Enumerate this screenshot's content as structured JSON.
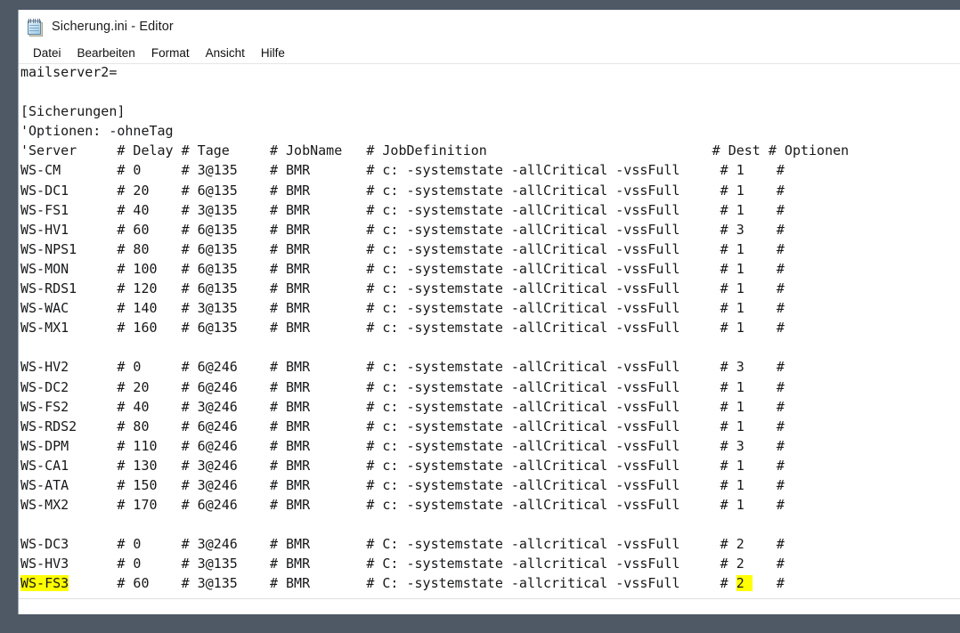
{
  "window": {
    "title": "Sicherung.ini - Editor",
    "icon": "notepad-icon"
  },
  "menu": {
    "items": [
      {
        "label": "Datei"
      },
      {
        "label": "Bearbeiten"
      },
      {
        "label": "Format"
      },
      {
        "label": "Ansicht"
      },
      {
        "label": "Hilfe"
      }
    ]
  },
  "colors": {
    "desktop": "#4e5965",
    "window": "#ffffff",
    "text": "#17181a",
    "highlight": "#ffff00"
  },
  "document": {
    "filename": "Sicherung.ini",
    "lines": [
      "mailserver2=",
      "",
      "[Sicherungen]",
      "'Optionen: -ohneTag",
      "'Server     # Delay # Tage     # JobName   # JobDefinition                            # Dest # Optionen",
      "WS-CM       # 0     # 3@135    # BMR       # c: -systemstate -allCritical -vssFull     # 1    #",
      "WS-DC1      # 20    # 6@135    # BMR       # c: -systemstate -allCritical -vssFull     # 1    #",
      "WS-FS1      # 40    # 3@135    # BMR       # c: -systemstate -allCritical -vssFull     # 1    #",
      "WS-HV1      # 60    # 6@135    # BMR       # c: -systemstate -allCritical -vssFull     # 3    #",
      "WS-NPS1     # 80    # 6@135    # BMR       # c: -systemstate -allCritical -vssFull     # 1    #",
      "WS-MON      # 100   # 6@135    # BMR       # c: -systemstate -allCritical -vssFull     # 1    #",
      "WS-RDS1     # 120   # 6@135    # BMR       # c: -systemstate -allCritical -vssFull     # 1    #",
      "WS-WAC      # 140   # 3@135    # BMR       # c: -systemstate -allCritical -vssFull     # 1    #",
      "WS-MX1      # 160   # 6@135    # BMR       # c: -systemstate -allCritical -vssFull     # 1    #",
      "",
      "WS-HV2      # 0     # 6@246    # BMR       # c: -systemstate -allCritical -vssFull     # 3    #",
      "WS-DC2      # 20    # 6@246    # BMR       # c: -systemstate -allCritical -vssFull     # 1    #",
      "WS-FS2      # 40    # 3@246    # BMR       # c: -systemstate -allCritical -vssFull     # 1    #",
      "WS-RDS2     # 80    # 6@246    # BMR       # c: -systemstate -allCritical -vssFull     # 1    #",
      "WS-DPM      # 110   # 6@246    # BMR       # c: -systemstate -allCritical -vssFull     # 3    #",
      "WS-CA1      # 130   # 3@246    # BMR       # c: -systemstate -allCritical -vssFull     # 1    #",
      "WS-ATA      # 150   # 3@246    # BMR       # c: -systemstate -allCritical -vssFull     # 1    #",
      "WS-MX2      # 170   # 6@246    # BMR       # c: -systemstate -allCritical -vssFull     # 1    #",
      "",
      "WS-DC3      # 0     # 3@246    # BMR       # C: -systemstate -allcritical -vssFull     # 2    #",
      "WS-HV3      # 0     # 3@135    # BMR       # C: -systemstate -allcritical -vssFull     # 2    #",
      "WS-FS3      # 60    # 3@135    # BMR       # C: -systemstate -allcritical -vssFull     # 2    #"
    ],
    "columns": [
      "Server",
      "Delay",
      "Tage",
      "JobName",
      "JobDefinition",
      "Dest",
      "Optionen"
    ],
    "highlighted": {
      "line_index": 26,
      "server_name": "WS-FS3",
      "dest_value": "2"
    },
    "last_line": {
      "server": "WS-FS3",
      "delay": "60",
      "tage": "3@135",
      "jobname": "BMR",
      "jobdefinition": "C: -systemstate -allcritical -vssFull",
      "dest": "2",
      "optionen": ""
    }
  }
}
